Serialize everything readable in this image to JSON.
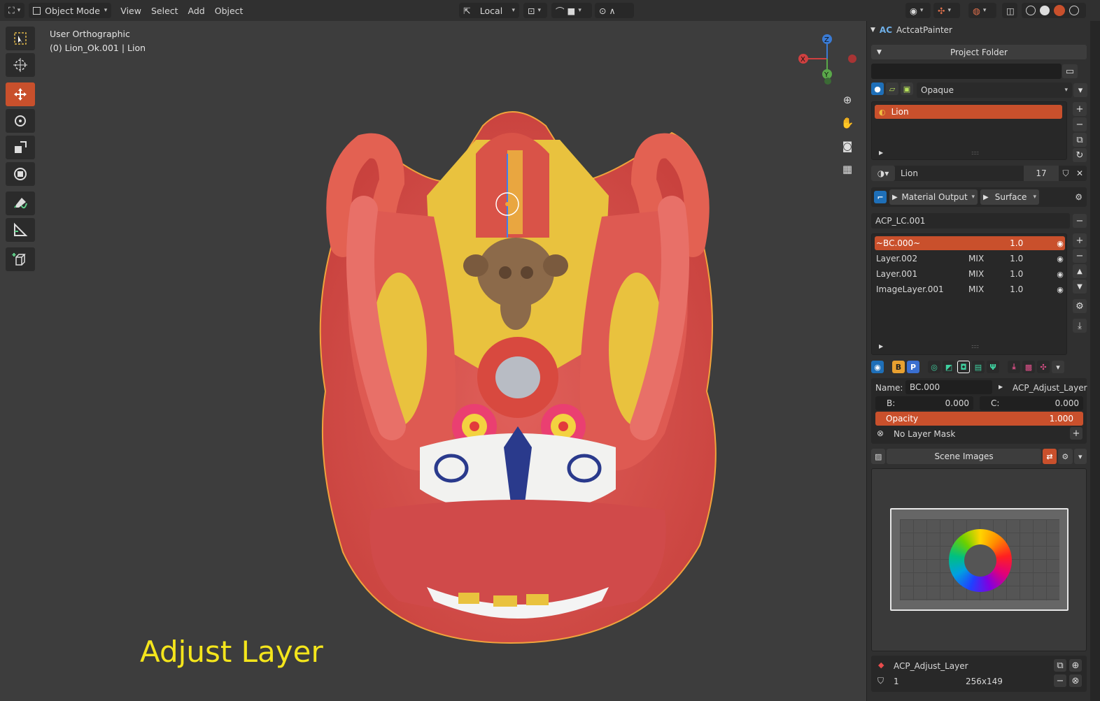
{
  "header": {
    "mode": "Object Mode",
    "menus": [
      "View",
      "Select",
      "Add",
      "Object"
    ],
    "transform_orientation": "Local"
  },
  "viewport": {
    "view_name": "User Orthographic",
    "object_info": "(0) Lion_Ok.001 | Lion",
    "overlay_label": "Adjust Layer",
    "gizmo": {
      "x": "X",
      "y": "Y",
      "z": "Z"
    }
  },
  "panel": {
    "addon_title": "ActcatPainter",
    "project_folder": "Project Folder",
    "blend_mode": "Opaque",
    "material_list": [
      {
        "name": "Lion"
      }
    ],
    "material_name": "Lion",
    "material_users": "17",
    "output_node": "Material Output",
    "output_target": "Surface",
    "layer_collection": "ACP_LC.001",
    "layers": [
      {
        "name": "~BC.000~",
        "mode": "",
        "value": "1.0",
        "selected": true
      },
      {
        "name": "Layer.002",
        "mode": "MIX",
        "value": "1.0",
        "selected": false
      },
      {
        "name": "Layer.001",
        "mode": "MIX",
        "value": "1.0",
        "selected": false
      },
      {
        "name": "ImageLayer.001",
        "mode": "MIX",
        "value": "1.0",
        "selected": false
      }
    ],
    "layer_props": {
      "name_label": "Name:",
      "name_value": "BC.000",
      "node_group": "ACP_Adjust_Layer",
      "b_label": "B:",
      "b_value": "0.000",
      "c_label": "C:",
      "c_value": "0.000",
      "opacity_label": "Opacity",
      "opacity_value": "1.000",
      "mask_label": "No Layer Mask"
    },
    "scene_images": "Scene Images",
    "image_block": {
      "name": "ACP_Adjust_Layer",
      "users": "1",
      "size": "256x149"
    }
  },
  "colors": {
    "accent": "#c9502c",
    "overlay_text": "#f4e51c",
    "panel_bg": "#303030",
    "viewport_bg": "#3d3d3d"
  }
}
